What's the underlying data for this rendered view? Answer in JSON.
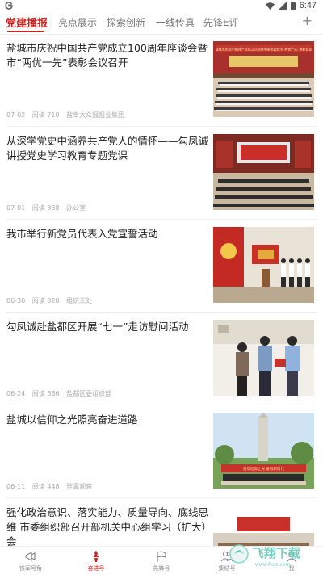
{
  "status_bar": {
    "time": "6:47"
  },
  "tabs": [
    {
      "label": "党建播报",
      "active": true
    },
    {
      "label": "亮点展示",
      "active": false
    },
    {
      "label": "探索创新",
      "active": false
    },
    {
      "label": "一线传真",
      "active": false
    },
    {
      "label": "先锋E评",
      "active": false
    }
  ],
  "tab_add_label": "+",
  "news": [
    {
      "title": "盐城市庆祝中国共产党成立100周年座谈会暨市“两优一先”表彰会议召开",
      "date": "07-02",
      "reads": "阅读 710",
      "source": "盐阜大众报报业集团",
      "image": "meeting-hall-photo",
      "image_text": "盐城市庆祝中国共产党成立100周年座谈会暨市“两优一先”表彰会议"
    },
    {
      "title": "从深学党史中涵养共产党人的情怀——勾凤诚讲授党史学习教育专题党课",
      "date": "07-01",
      "reads": "阅读 388",
      "source": "办公室",
      "image": "lecture-hall-photo"
    },
    {
      "title": "我市举行新党员代表入党宣誓活动",
      "date": "06-30",
      "reads": "阅读 328",
      "source": "组织三处",
      "image": "oath-ceremony-photo"
    },
    {
      "title": "勾凤诚赴盐都区开展“七一”走访慰问活动",
      "date": "06-24",
      "reads": "阅读 386",
      "source": "盐都区委组织部",
      "image": "visit-photo"
    },
    {
      "title": "盐城以信仰之光照亮奋进道路",
      "date": "06-11",
      "reads": "阅读 448",
      "source": "登瀛观察",
      "image": "monument-photo",
      "image_text": "百年信仰之光 奋进新时代"
    },
    {
      "title": "强化政治意识、落实能力、质量导向、底线思维 市委组织部召开部机关中心组学习（扩大）会",
      "date": "",
      "reads": "",
      "source": "",
      "image": "study-meeting-photo"
    }
  ],
  "bottom_nav": [
    {
      "label": "铁军号角",
      "icon": "horn-icon",
      "active": false
    },
    {
      "label": "奋进号",
      "icon": "torch-icon",
      "active": true
    },
    {
      "label": "先锋号",
      "icon": "flag-icon",
      "active": false
    },
    {
      "label": "集结号",
      "icon": "people-icon",
      "active": false
    },
    {
      "label": "我",
      "icon": "user-icon",
      "active": false
    }
  ],
  "watermark": {
    "text": "飞翔下载",
    "sub": "www.fxxz.com"
  },
  "colors": {
    "accent": "#c9221f",
    "text": "#222222",
    "muted": "#aaaaaa"
  }
}
